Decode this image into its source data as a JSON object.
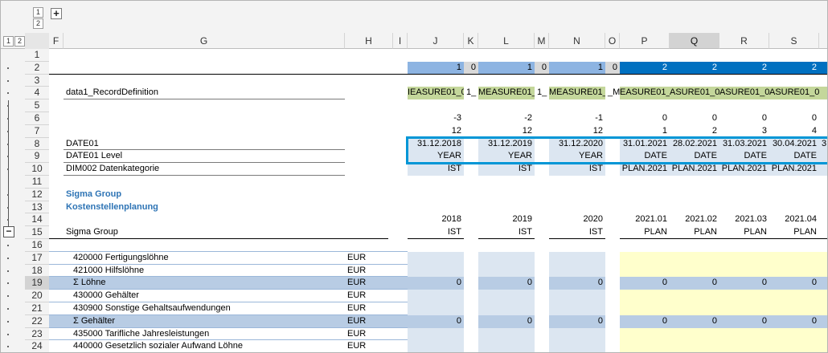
{
  "outline": {
    "col_levels": [
      "1",
      "2"
    ],
    "row_levels": [
      "1",
      "2"
    ],
    "expand_symbol": "+",
    "collapse_symbol": "−"
  },
  "columns": [
    "F",
    "G",
    "H",
    "I",
    "J",
    "K",
    "L",
    "M",
    "N",
    "O",
    "P",
    "Q",
    "R",
    "S"
  ],
  "selected_column": "Q",
  "rows": [
    "1",
    "2",
    "3",
    "4",
    "5",
    "6",
    "7",
    "8",
    "9",
    "10",
    "11",
    "12",
    "13",
    "14",
    "15",
    "16",
    "17",
    "18",
    "19",
    "20",
    "21",
    "22",
    "23",
    "24"
  ],
  "selected_row": "19",
  "colors": {
    "accent_dark_blue": "#0070c0",
    "light_blue": "#dce6f1",
    "mid_blue": "#b8cce4",
    "header_blue": "#8db4e2",
    "green": "#c4d79b",
    "yellow": "#ffffcc",
    "grey": "#d9d9d9",
    "selection_border": "#0096d6",
    "title_blue": "#2e74b5"
  },
  "r2": {
    "j": "1",
    "k": "0",
    "l": "1",
    "m": "0",
    "n": "1",
    "o": "0",
    "p": "2",
    "q": "2",
    "r": "2",
    "s": "2"
  },
  "r4": {
    "label": "data1_RecordDefinition",
    "j": "IEASURE01_0",
    "k": "1_",
    "l": "MEASURE01_0",
    "m": "1_",
    "n": "MEASURE01_0",
    "o": "_ME",
    "p": "EASURE01_0",
    "q": "ASURE01_0",
    "r": "ASURE01_0",
    "s": "ASURE01_0"
  },
  "r6": {
    "j": "-3",
    "l": "-2",
    "n": "-1",
    "p": "0",
    "q": "0",
    "r": "0",
    "s": "0"
  },
  "r7": {
    "j": "12",
    "l": "12",
    "n": "12",
    "p": "1",
    "q": "2",
    "r": "3",
    "s": "4"
  },
  "r8": {
    "label": "DATE01",
    "j": "31.12.2018",
    "l": "31.12.2019",
    "n": "31.12.2020",
    "p": "31.01.2021",
    "q": "28.02.2021",
    "r": "31.03.2021",
    "s": "30.04.2021",
    "t": "3"
  },
  "r9": {
    "label": "DATE01 Level",
    "j": "YEAR",
    "l": "YEAR",
    "n": "YEAR",
    "p": "DATE",
    "q": "DATE",
    "r": "DATE",
    "s": "DATE"
  },
  "r10": {
    "label": "DIM002 Datenkategorie",
    "j": "IST",
    "l": "IST",
    "n": "IST",
    "p": "PLAN.2021",
    "q": "PLAN.2021",
    "r": "PLAN.2021",
    "s": "PLAN.2021"
  },
  "r12": {
    "label": "Sigma Group"
  },
  "r13": {
    "label": "Kostenstellenplanung"
  },
  "r14": {
    "j": "2018",
    "l": "2019",
    "n": "2020",
    "p": "2021.01",
    "q": "2021.02",
    "r": "2021.03",
    "s": "2021.04"
  },
  "r15": {
    "label": "Sigma Group",
    "j": "IST",
    "l": "IST",
    "n": "IST",
    "p": "PLAN",
    "q": "PLAN",
    "r": "PLAN",
    "s": "PLAN"
  },
  "data_rows": [
    {
      "row": 17,
      "label": "420000 Fertigungslöhne",
      "unit": "EUR",
      "type": "detail"
    },
    {
      "row": 18,
      "label": "421000 Hilfslöhne",
      "unit": "EUR",
      "type": "detail"
    },
    {
      "row": 19,
      "label": "Σ Löhne",
      "unit": "EUR",
      "type": "sum",
      "j": "0",
      "l": "0",
      "n": "0",
      "p": "0",
      "q": "0",
      "r": "0",
      "s": "0"
    },
    {
      "row": 20,
      "label": "430000 Gehälter",
      "unit": "EUR",
      "type": "detail"
    },
    {
      "row": 21,
      "label": "430900 Sonstige Gehaltsaufwendungen",
      "unit": "EUR",
      "type": "detail"
    },
    {
      "row": 22,
      "label": "Σ Gehälter",
      "unit": "EUR",
      "type": "sum",
      "j": "0",
      "l": "0",
      "n": "0",
      "p": "0",
      "q": "0",
      "r": "0",
      "s": "0"
    },
    {
      "row": 23,
      "label": "435000 Tarifliche Jahresleistungen",
      "unit": "EUR",
      "type": "detail"
    },
    {
      "row": 24,
      "label": "440000 Gesetzlich sozialer Aufwand Löhne",
      "unit": "EUR",
      "type": "detail"
    }
  ]
}
